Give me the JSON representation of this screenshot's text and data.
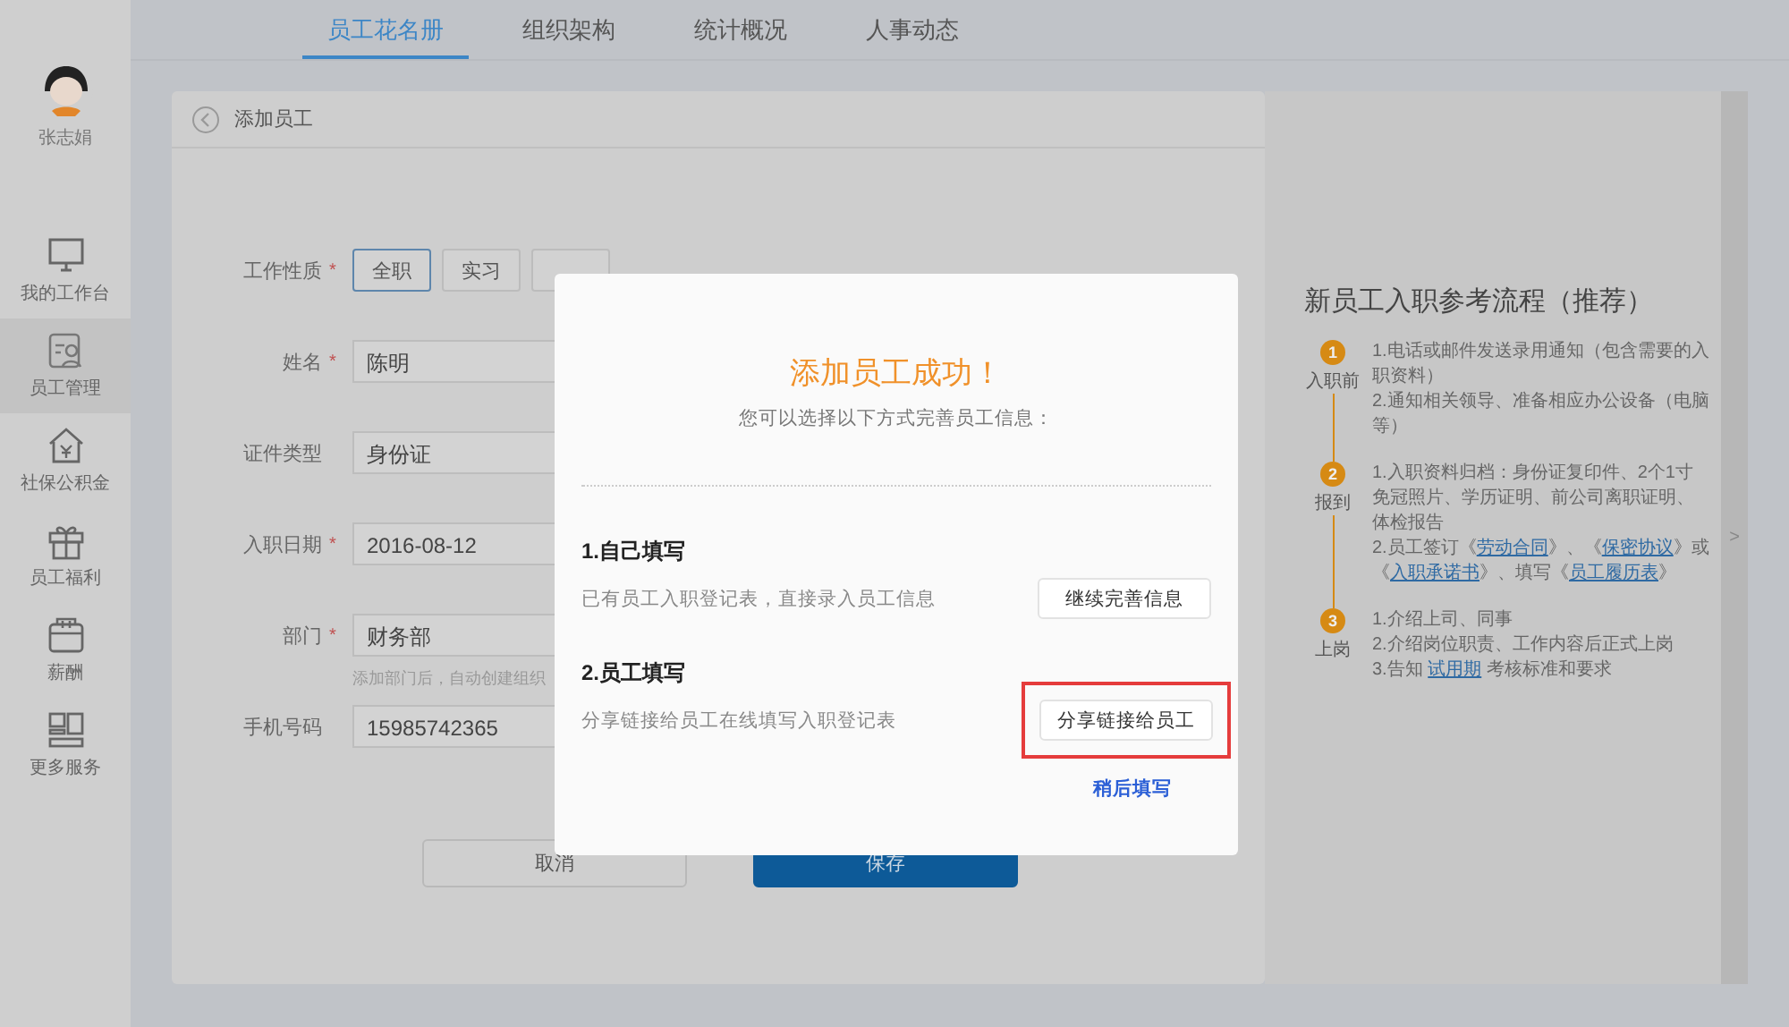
{
  "user": {
    "name": "张志娟"
  },
  "sidebar": {
    "items": [
      {
        "label": "我的工作台",
        "kind": "monitor",
        "selected": false
      },
      {
        "label": "员工管理",
        "kind": "person",
        "selected": true
      },
      {
        "label": "社保公积金",
        "kind": "house",
        "selected": false
      },
      {
        "label": "员工福利",
        "kind": "gift",
        "selected": false
      },
      {
        "label": "薪酬",
        "kind": "wallet",
        "selected": false
      },
      {
        "label": "更多服务",
        "kind": "grid",
        "selected": false
      }
    ]
  },
  "tabs": [
    {
      "label": "员工花名册",
      "selected": true
    },
    {
      "label": "组织架构",
      "selected": false
    },
    {
      "label": "统计概况",
      "selected": false
    },
    {
      "label": "人事动态",
      "selected": false
    }
  ],
  "page": {
    "title": "添加员工"
  },
  "form": {
    "rows": [
      {
        "kind": "choice",
        "label": "工作性质",
        "required_mark": "*",
        "options": [
          {
            "label": "全职",
            "selected": true
          },
          {
            "label": "实习",
            "selected": false
          },
          {
            "selected": false
          }
        ]
      },
      {
        "kind": "field",
        "label": "姓名",
        "required_mark": "*",
        "value": "陈明"
      },
      {
        "kind": "field",
        "label": "证件类型",
        "value": "身份证"
      },
      {
        "kind": "field",
        "label": "入职日期",
        "required_mark": "*",
        "value": "2016-08-12"
      },
      {
        "kind": "field",
        "label": "部门",
        "required_mark": "*",
        "value": "财务部",
        "hint": "添加部门后，自动创建组织"
      },
      {
        "kind": "field",
        "label": "手机号码",
        "value": "15985742365"
      }
    ],
    "buttons": [
      {
        "label": "取消",
        "primary": false
      },
      {
        "label": "保存",
        "primary": true
      }
    ]
  },
  "guide": {
    "title": "新员工入职参考流程（推荐）",
    "steps": [
      {
        "number": "1",
        "label": "入职前",
        "lines": [
          [
            {
              "text": "1.电话或邮件发送录用通知（包含需要的入职资料）"
            }
          ],
          [
            {
              "text": "2.通知相关领导、准备相应办公设备（电脑等）"
            }
          ]
        ]
      },
      {
        "number": "2",
        "label": "报到",
        "lines": [
          [
            {
              "text": "1.入职资料归档：身份证复印件、2个1寸免冠照片、学历证明、前公司离职证明、体检报告"
            }
          ],
          [
            {
              "text": "2.员工签订《"
            },
            {
              "text": "劳动合同",
              "link": true
            },
            {
              "text": "》、《"
            },
            {
              "text": "保密协议",
              "link": true
            },
            {
              "text": "》或《"
            },
            {
              "text": "入职承诺书",
              "link": true
            },
            {
              "text": "》、填写《"
            },
            {
              "text": "员工履历表",
              "link": true
            },
            {
              "text": "》"
            }
          ]
        ]
      },
      {
        "number": "3",
        "label": "上岗",
        "lines": [
          [
            {
              "text": "1.介绍上司、同事"
            }
          ],
          [
            {
              "text": "2.介绍岗位职责、工作内容后正式上岗"
            }
          ],
          [
            {
              "text": "3.告知 "
            },
            {
              "text": "试用期",
              "link": true
            },
            {
              "text": " 考核标准和要求"
            }
          ]
        ]
      }
    ]
  },
  "panel_toggle": ">",
  "dialog": {
    "title": "添加员工成功！",
    "subtitle": "您可以选择以下方式完善员工信息：",
    "options": [
      {
        "title": "1.自己填写",
        "description": "已有员工入职登记表，直接录入员工信息",
        "button": "继续完善信息",
        "highlighted": false
      },
      {
        "title": "2.员工填写",
        "description": "分享链接给员工在线填写入职登记表",
        "button": "分享链接给员工",
        "highlighted": true
      }
    ],
    "later_link": "稍后填写"
  }
}
